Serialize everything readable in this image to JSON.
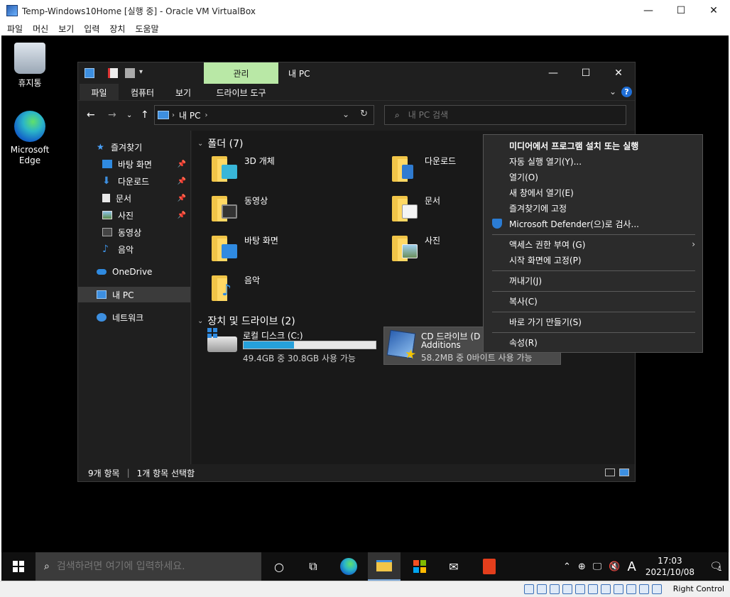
{
  "vbox": {
    "title": "Temp-Windows10Home [실행 중] - Oracle VM VirtualBox",
    "menu": [
      "파일",
      "머신",
      "보기",
      "입력",
      "장치",
      "도움말"
    ],
    "host_key": "Right Control"
  },
  "desktop": {
    "icons": [
      {
        "label": "휴지통"
      },
      {
        "label": "Microsoft Edge"
      }
    ]
  },
  "explorer": {
    "manage_tab": "관리",
    "title": "내 PC",
    "ribbon_tabs": {
      "file": "파일",
      "computer": "컴퓨터",
      "view": "보기",
      "drive_tools": "드라이브 도구"
    },
    "address": {
      "crumb": "내 PC"
    },
    "search_placeholder": "내 PC 검색",
    "sidebar": {
      "quick_access": "즐겨찾기",
      "desktop": "바탕 화면",
      "downloads": "다운로드",
      "documents": "문서",
      "pictures": "사진",
      "videos": "동영상",
      "music": "음악",
      "onedrive": "OneDrive",
      "this_pc": "내 PC",
      "network": "네트워크"
    },
    "folders_header": "폴더 (7)",
    "folders": {
      "objects3d": "3D 개체",
      "downloads": "다운로드",
      "videos": "동영상",
      "documents": "문서",
      "desktop": "바탕 화면",
      "pictures": "사진",
      "music": "음악"
    },
    "drives_header": "장치 및 드라이브 (2)",
    "drives": {
      "local": {
        "name": "로컬 디스크 (C:)",
        "size": "49.4GB 중 30.8GB 사용 가능",
        "used_fraction": 0.38
      },
      "cd": {
        "name": "CD 드라이브 (D",
        "name2": "Additions",
        "size": "58.2MB 중 0바이트 사용 가능"
      }
    },
    "status": {
      "items": "9개 항목",
      "selected": "1개 항목 선택함"
    }
  },
  "context_menu": {
    "install": "미디어에서 프로그램 설치 또는 실행",
    "autoplay": "자동 실행 열기(Y)...",
    "open": "열기(O)",
    "open_new": "새 창에서 열기(E)",
    "pin_quick": "즐겨찾기에 고정",
    "defender": "Microsoft Defender(으)로 검사...",
    "access": "액세스 권한 부여 (G)",
    "pin_start": "시작 화면에 고정(P)",
    "eject": "꺼내기(J)",
    "copy": "복사(C)",
    "shortcut": "바로 가기 만들기(S)",
    "properties": "속성(R)"
  },
  "taskbar": {
    "search_placeholder": "검색하려면 여기에 입력하세요.",
    "ime": "A",
    "time": "17:03",
    "date": "2021/10/08",
    "notifications": "1"
  }
}
